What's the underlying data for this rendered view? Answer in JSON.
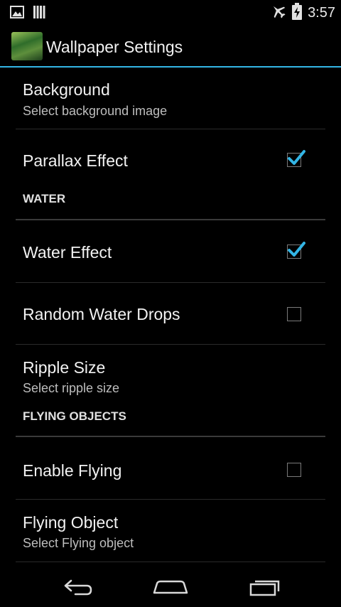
{
  "status": {
    "time": "3:57"
  },
  "appbar": {
    "title": "Wallpaper Settings"
  },
  "prefs": {
    "background": {
      "title": "Background",
      "summary": "Select background image"
    },
    "parallax": {
      "title": "Parallax Effect",
      "checked": true
    },
    "water_header": "WATER",
    "water_effect": {
      "title": "Water Effect",
      "checked": true
    },
    "random_drops": {
      "title": "Random Water Drops",
      "checked": false
    },
    "ripple_size": {
      "title": "Ripple Size",
      "summary": "Select ripple size"
    },
    "flying_header": "FLYING OBJECTS",
    "enable_flying": {
      "title": "Enable Flying",
      "checked": false
    },
    "flying_object": {
      "title": "Flying Object",
      "summary": "Select Flying object"
    }
  },
  "colors": {
    "accent": "#33b5e5",
    "background": "#000000",
    "checkmark": "#33b5e5"
  },
  "icons": {
    "status_left": [
      "image-notification-icon",
      "signal-bars-icon"
    ],
    "status_right": [
      "airplane-mode-icon",
      "battery-charging-icon"
    ],
    "nav": [
      "back-icon",
      "home-icon",
      "recent-apps-icon"
    ]
  }
}
